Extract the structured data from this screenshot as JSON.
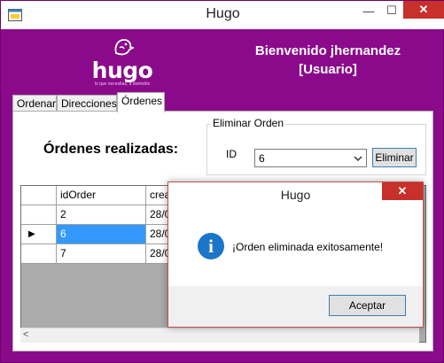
{
  "window": {
    "title": "Hugo",
    "minimize_glyph": "—",
    "maximize_glyph": "☐",
    "close_glyph": "✕"
  },
  "header": {
    "logo_text": "hugo",
    "logo_tagline": "lo que necesitas, a domicilio",
    "welcome_line1": "Bienvenido jhernandez",
    "welcome_line2": "[Usuario]",
    "accent_color": "#8b0a8b"
  },
  "tabs": [
    {
      "label": "Ordenar"
    },
    {
      "label": "Direcciones"
    },
    {
      "label": "Órdenes"
    }
  ],
  "orders": {
    "title": "Órdenes realizadas:",
    "delete_group": {
      "label": "Eliminar Orden",
      "id_label": "ID",
      "selected_id": "6",
      "delete_button": "Eliminar"
    },
    "grid": {
      "columns": [
        "idOrder",
        "crea"
      ],
      "rows": [
        {
          "idOrder": "2",
          "created": "28/0"
        },
        {
          "idOrder": "6",
          "created": "28/0"
        },
        {
          "idOrder": "7",
          "created": "28/0"
        }
      ],
      "selected_row_index": 1,
      "current_row_marker": "▶"
    }
  },
  "dialog": {
    "title": "Hugo",
    "close_glyph": "✕",
    "icon": "info-icon",
    "icon_glyph": "i",
    "message": "¡Orden eliminada exitosamente!",
    "ok_button": "Aceptar"
  }
}
